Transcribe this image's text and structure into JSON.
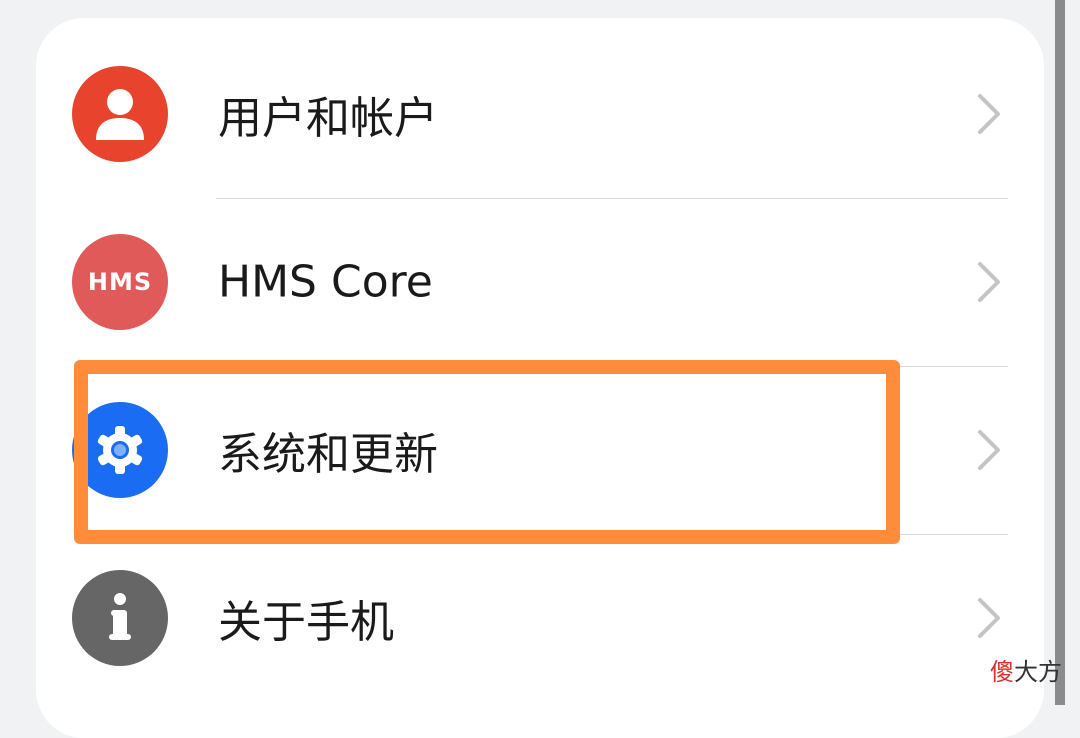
{
  "settings": {
    "items": [
      {
        "label": "用户和帐户",
        "icon": "user-icon",
        "color": "#e8432c"
      },
      {
        "label": "HMS Core",
        "icon": "hms-core-icon",
        "icon_text": "HMS",
        "color": "#e05a5a"
      },
      {
        "label": "系统和更新",
        "icon": "gear-icon",
        "color": "#1a6cf3"
      },
      {
        "label": "关于手机",
        "icon": "info-icon",
        "color": "#666666"
      }
    ]
  },
  "highlight": {
    "color": "#ff8c3a",
    "target": "系统和更新"
  },
  "watermark": {
    "first_char": "傻",
    "rest": "大方"
  }
}
